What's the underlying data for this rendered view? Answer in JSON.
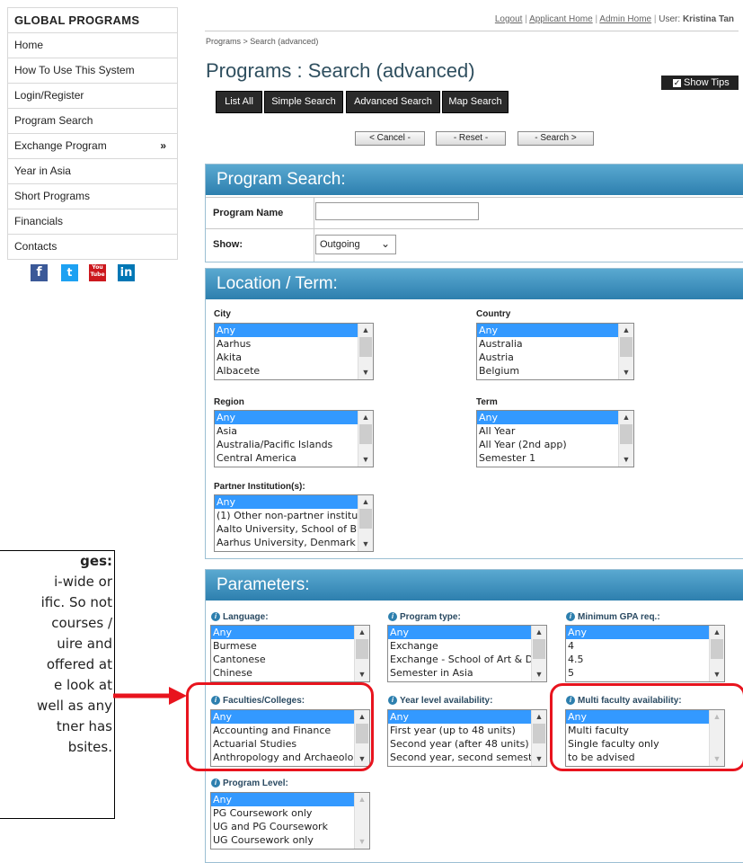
{
  "sidebar": {
    "heading": "GLOBAL PROGRAMS",
    "items": [
      {
        "label": "Home"
      },
      {
        "label": "How To Use This System"
      },
      {
        "label": "Login/Register"
      },
      {
        "label": "Program Search"
      },
      {
        "label": "Exchange Program",
        "chevron": "»"
      },
      {
        "label": "Year in Asia"
      },
      {
        "label": "Short Programs"
      },
      {
        "label": "Financials"
      },
      {
        "label": "Contacts"
      }
    ],
    "social": [
      "f",
      "t",
      "You Tube",
      "in"
    ]
  },
  "top": {
    "logout": "Logout",
    "applicant_home": "Applicant Home",
    "admin_home": "Admin Home",
    "user_label": "User:",
    "user_name": "Kristina Tan",
    "breadcrumb": "Programs > Search (advanced)",
    "title": "Programs : Search (advanced)",
    "show_tips": "Show Tips",
    "show_tips_checked": "✓"
  },
  "nav_buttons": {
    "list_all": "List All",
    "simple": "Simple Search",
    "advanced": "Advanced Search",
    "map": "Map Search"
  },
  "actions": {
    "cancel": "< Cancel -",
    "reset": "- Reset -",
    "search": "- Search >"
  },
  "program_search": {
    "heading": "Program Search:",
    "name_label": "Program Name",
    "name_value": "",
    "show_label": "Show:",
    "show_value": "Outgoing"
  },
  "location": {
    "heading": "Location / Term:",
    "city": {
      "label": "City",
      "options": [
        "Any",
        "Aarhus",
        "Akita",
        "Albacete"
      ]
    },
    "country": {
      "label": "Country",
      "options": [
        "Any",
        "Australia",
        "Austria",
        "Belgium"
      ]
    },
    "region": {
      "label": "Region",
      "options": [
        "Any",
        "Asia",
        "Australia/Pacific Islands",
        "Central America"
      ]
    },
    "term": {
      "label": "Term",
      "options": [
        "Any",
        "All Year",
        "All Year (2nd app)",
        "Semester 1"
      ]
    },
    "partner": {
      "label": "Partner Institution(s):",
      "options": [
        "Any",
        "(1) Other non-partner institu",
        "Aalto University, School of B",
        "Aarhus University, Denmark"
      ]
    }
  },
  "parameters": {
    "heading": "Parameters:",
    "language": {
      "label": "Language:",
      "options": [
        "Any",
        "Burmese",
        "Cantonese",
        "Chinese"
      ]
    },
    "program_type": {
      "label": "Program type:",
      "options": [
        "Any",
        "Exchange",
        "Exchange - School of Art & D",
        "Semester in Asia"
      ]
    },
    "min_gpa": {
      "label": "Minimum GPA req.:",
      "options": [
        "Any",
        "4",
        "4.5",
        "5"
      ]
    },
    "faculties": {
      "label": "Faculties/Colleges:",
      "options": [
        "Any",
        "Accounting and Finance",
        "Actuarial Studies",
        "Anthropology and Archaeolo"
      ]
    },
    "year_level": {
      "label": "Year level availability:",
      "options": [
        "Any",
        "First year (up to 48 units)",
        "Second year (after 48 units)",
        "Second year, second semest"
      ]
    },
    "multi_faculty": {
      "label": "Multi faculty availability:",
      "options": [
        "Any",
        "Multi faculty",
        "Single faculty only",
        "to be advised"
      ]
    },
    "program_level": {
      "label": "Program Level:",
      "options": [
        "Any",
        "PG Coursework only",
        "UG and PG Coursework",
        "UG Coursework only"
      ]
    }
  },
  "annotation": {
    "lines": [
      "ges:",
      "i-wide or",
      "ific. So not",
      "courses /",
      "uire and",
      "offered at",
      "e look at",
      "well as any",
      "tner has",
      "bsites."
    ]
  },
  "colors": {
    "panel_header": "#2d7fae",
    "highlight": "#e8141e",
    "selected_option": "#3399ff"
  }
}
